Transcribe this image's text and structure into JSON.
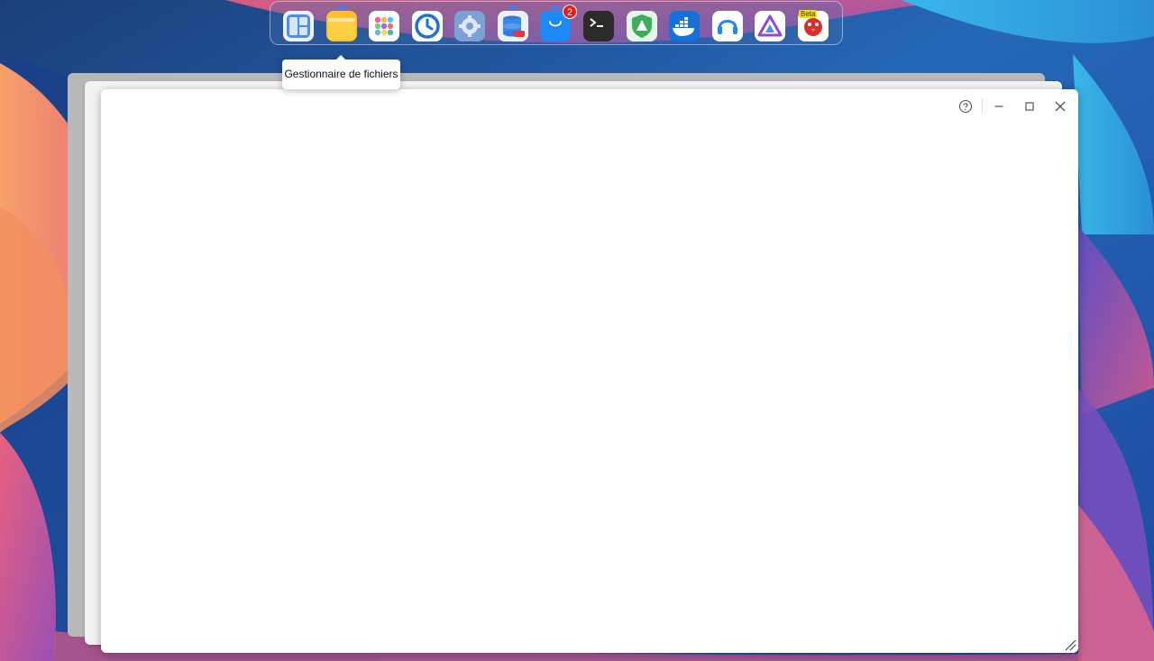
{
  "dock": {
    "items": [
      {
        "icon": "control-panel-icon",
        "running": false
      },
      {
        "icon": "file-manager-icon",
        "running": true
      },
      {
        "icon": "app-grid-icon",
        "running": false
      },
      {
        "icon": "backup-clock-icon",
        "running": false
      },
      {
        "icon": "settings-gear-icon",
        "running": false
      },
      {
        "icon": "storage-database-icon",
        "running": true
      },
      {
        "icon": "app-center-bag-icon",
        "running": true,
        "badge": "2"
      },
      {
        "icon": "terminal-icon",
        "running": false
      },
      {
        "icon": "security-shield-icon",
        "running": false
      },
      {
        "icon": "docker-whale-icon",
        "running": false
      },
      {
        "icon": "support-headset-icon",
        "running": false
      },
      {
        "icon": "jellyfin-icon",
        "running": false
      },
      {
        "icon": "red-bird-icon",
        "running": false,
        "tag": "Beta"
      }
    ]
  },
  "tooltip": {
    "text": "Gestionnaire de fichiers"
  },
  "window": {
    "controls": [
      "help-icon",
      "minimize-icon",
      "maximize-icon",
      "close-icon"
    ]
  },
  "colors": {
    "accent": "#3b82f6",
    "badge": "#e11d1d",
    "window_bg": "#ffffff"
  }
}
